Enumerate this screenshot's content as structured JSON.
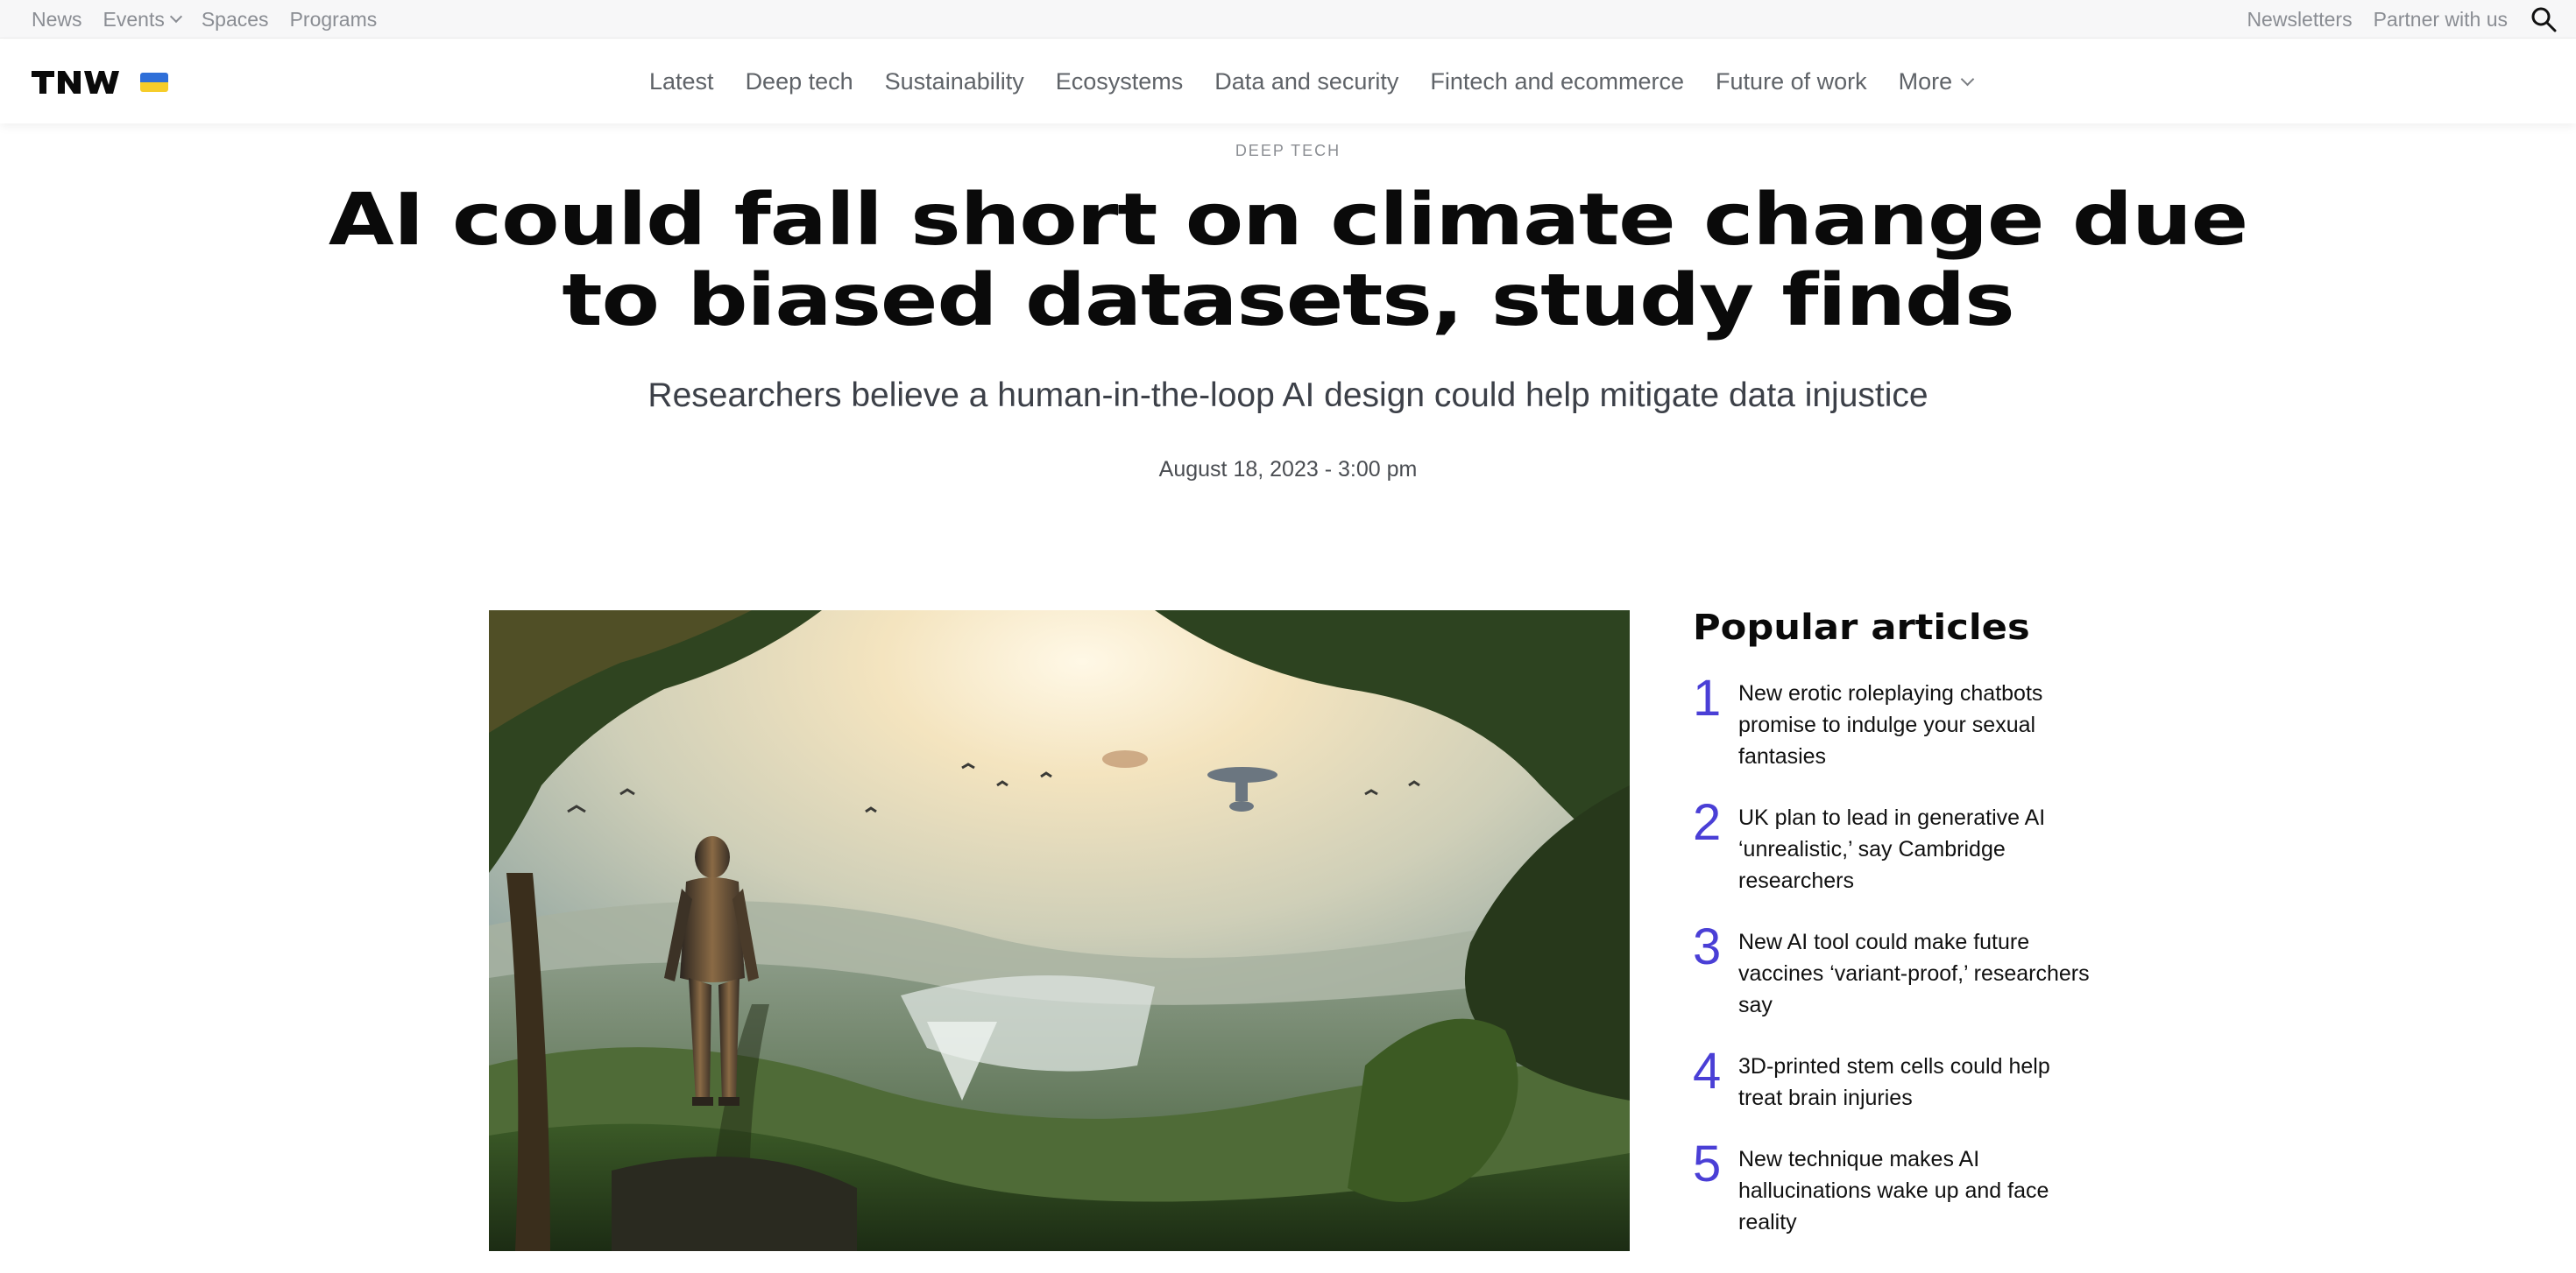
{
  "util_bar": {
    "left_links": [
      {
        "label": "News",
        "has_dropdown": false
      },
      {
        "label": "Events",
        "has_dropdown": true
      },
      {
        "label": "Spaces",
        "has_dropdown": false
      },
      {
        "label": "Programs",
        "has_dropdown": false
      }
    ],
    "right_links": [
      "Newsletters",
      "Partner with us"
    ],
    "search_icon": "search-icon"
  },
  "main_nav": {
    "logo": "TNW",
    "flag_colors": [
      "#2f6fd8",
      "#f6cd2a"
    ],
    "items": [
      "Latest",
      "Deep tech",
      "Sustainability",
      "Ecosystems",
      "Data and security",
      "Fintech and ecommerce",
      "Future of work"
    ],
    "more_label": "More"
  },
  "article": {
    "category": "DEEP TECH",
    "headline_line1": "AI could fall short on climate change due",
    "headline_line2": "to biased datasets, study finds",
    "subtitle": "Researchers believe a human-in-the-loop AI design could help mitigate data injustice",
    "date": "August 18, 2023 - 3:00 pm"
  },
  "sidebar": {
    "title": "Popular articles",
    "accent_color": "#4a3fd6",
    "items": [
      {
        "num": "1",
        "text": "New erotic roleplaying chatbots promise to indulge your sexual fantasies"
      },
      {
        "num": "2",
        "text": "UK plan to lead in generative AI ‘unrealistic,’ say Cambridge researchers"
      },
      {
        "num": "3",
        "text": "New AI tool could make future vaccines ‘variant-proof,’ researchers say"
      },
      {
        "num": "4",
        "text": "3D-printed stem cells could help treat brain injuries"
      },
      {
        "num": "5",
        "text": "New technique makes AI hallucinations wake up and face reality"
      }
    ]
  }
}
